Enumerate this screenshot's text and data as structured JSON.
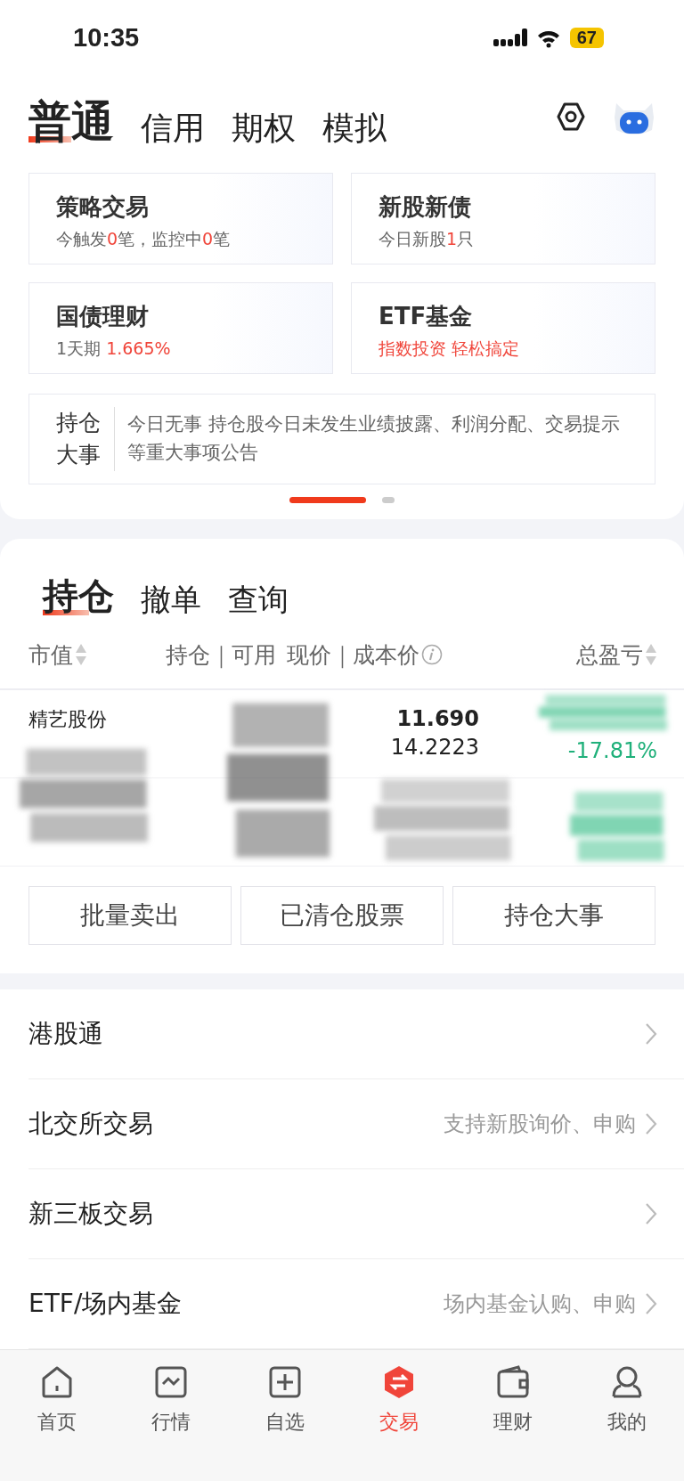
{
  "status_bar": {
    "time": "10:35",
    "battery": "67"
  },
  "account_tabs": [
    {
      "label": "普通",
      "selected": true
    },
    {
      "label": "信用",
      "selected": false
    },
    {
      "label": "期权",
      "selected": false
    },
    {
      "label": "模拟",
      "selected": false
    }
  ],
  "feature_cards": [
    {
      "title": "策略交易",
      "subtitle": [
        {
          "text": "今触发",
          "highlight": false
        },
        {
          "text": "0",
          "highlight": true
        },
        {
          "text": "笔，监控中",
          "highlight": false
        },
        {
          "text": "0",
          "highlight": true
        },
        {
          "text": "笔",
          "highlight": false
        }
      ]
    },
    {
      "title": "新股新债",
      "subtitle": [
        {
          "text": "今日新股",
          "highlight": false
        },
        {
          "text": "1",
          "highlight": true
        },
        {
          "text": "只",
          "highlight": false
        }
      ]
    },
    {
      "title": "国债理财",
      "subtitle": [
        {
          "text": "1天期 ",
          "highlight": false
        },
        {
          "text": " 1.665%",
          "highlight": true
        }
      ]
    },
    {
      "title": "ETF基金",
      "subtitle": [
        {
          "text": "指数投资 轻松搞定",
          "highlight": true
        }
      ]
    }
  ],
  "holding_events": {
    "label": "持仓大事",
    "text": "今日无事 持仓股今日未发生业绩披露、利润分配、交易提示等重大事项公告"
  },
  "pager": [
    {
      "selected": true
    },
    {
      "selected": false
    }
  ],
  "position_tabs": [
    {
      "label": "持仓",
      "selected": true
    },
    {
      "label": "撤单",
      "selected": false
    },
    {
      "label": "查询",
      "selected": false
    }
  ],
  "columns": [
    {
      "label": "市值",
      "sortable": true,
      "info": false
    },
    {
      "label": "持仓｜可用",
      "sortable": false,
      "info": false
    },
    {
      "label": "现价｜成本价",
      "sortable": false,
      "info": true
    },
    {
      "label": "总盈亏",
      "sortable": true,
      "info": false
    }
  ],
  "rows": [
    {
      "name": "精艺股份",
      "price": "11.690",
      "cost": "14.2223",
      "pl_percent": "-17.81%"
    }
  ],
  "action_buttons": [
    "批量卖出",
    "已清仓股票",
    "持仓大事"
  ],
  "markets": [
    {
      "label": "港股通"
    },
    {
      "label": "北交所交易",
      "hint": "支持新股询价、申购"
    },
    {
      "label": "新三板交易"
    },
    {
      "label": "ETF/场内基金",
      "hint": "场内基金认购、申购"
    }
  ],
  "nav": [
    {
      "label": "首页",
      "selected": false
    },
    {
      "label": "行情",
      "selected": false
    },
    {
      "label": "自选",
      "selected": false
    },
    {
      "label": "交易",
      "selected": true
    },
    {
      "label": "理财",
      "selected": false
    },
    {
      "label": "我的",
      "selected": false
    }
  ]
}
